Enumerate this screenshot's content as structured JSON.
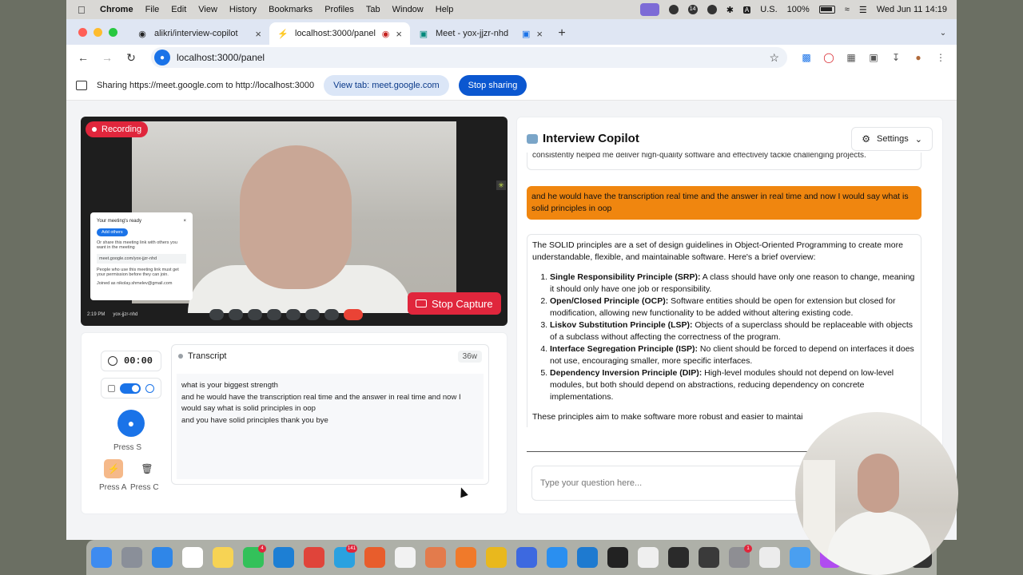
{
  "menubar": {
    "app_name": "Chrome",
    "items": [
      "File",
      "Edit",
      "View",
      "History",
      "Bookmarks",
      "Profiles",
      "Tab",
      "Window",
      "Help"
    ],
    "notification_count": "14",
    "input_source": "U.S.",
    "battery": "100%",
    "datetime": "Wed Jun 11  14:19"
  },
  "tabs": [
    {
      "title": "alikri/interview-copilot",
      "icon": "github-icon",
      "active": false
    },
    {
      "title": "localhost:3000/panel",
      "icon": "bolt-icon",
      "active": true
    },
    {
      "title": "Meet - yox-jjzr-nhd",
      "icon": "meet-icon",
      "active": false
    }
  ],
  "toolbar": {
    "url": "localhost:3000/panel"
  },
  "sharebar": {
    "message": "Sharing https://meet.google.com to http://localhost:3000",
    "view_tab_label": "View tab: meet.google.com",
    "stop_sharing_label": "Stop sharing"
  },
  "video": {
    "recording_label": "Recording",
    "stop_capture_label": "Stop Capture",
    "meet_time": "2:19 PM",
    "meet_code": "yox-jjzr-nhd",
    "meet_card": {
      "title": "Your meeting's ready",
      "add_others": "Add others",
      "share_text": "Or share this meeting link with others you want in the meeting",
      "link": "meet.google.com/yox-jjzr-nhd",
      "note": "People who use this meeting link must get your permission before they can join.",
      "joined_as": "Joined as nikolay.shmelev@gmail.com"
    }
  },
  "controls": {
    "timer": "00:00",
    "press_s": "Press  S",
    "press_a": "Press  A",
    "press_c": "Press  C"
  },
  "transcript": {
    "title": "Transcript",
    "word_count": "36w",
    "lines": [
      "what is your biggest strength",
      "and he would have the transcription real time and the answer in real time and now I would say what is solid principles in oop",
      "and you have solid principles thank you bye"
    ]
  },
  "copilot": {
    "title": "Interview Copilot",
    "settings_label": "Settings",
    "prev_message": "consistently helped me deliver high-quality software and effectively tackle challenging projects.",
    "user_message": "and he would have the transcription real time and the answer in real time and now I would say what is solid principles in oop",
    "ai_intro": "The SOLID principles are a set of design guidelines in Object-Oriented Programming to create more understandable, flexible, and maintainable software. Here's a brief overview:",
    "principles": [
      {
        "term": "Single Responsibility Principle (SRP):",
        "desc": " A class should have only one reason to change, meaning it should only have one job or responsibility."
      },
      {
        "term": "Open/Closed Principle (OCP):",
        "desc": " Software entities should be open for extension but closed for modification, allowing new functionality to be added without altering existing code."
      },
      {
        "term": "Liskov Substitution Principle (LSP):",
        "desc": " Objects of a superclass should be replaceable with objects of a subclass without affecting the correctness of the program."
      },
      {
        "term": "Interface Segregation Principle (ISP):",
        "desc": " No client should be forced to depend on interfaces it does not use, encouraging smaller, more specific interfaces."
      },
      {
        "term": "Dependency Inversion Principle (DIP):",
        "desc": " High-level modules should not depend on low-level modules, but both should depend on abstractions, reducing dependency on concrete implementations."
      }
    ],
    "ai_outro": "These principles aim to make software more robust and easier to maintai",
    "input_placeholder": "Type your question here..."
  },
  "dock": {
    "icons": [
      {
        "name": "finder-icon",
        "color": "#3d8bf0"
      },
      {
        "name": "launchpad-icon",
        "color": "#8a8f99"
      },
      {
        "name": "safari-icon",
        "color": "#2f86e8"
      },
      {
        "name": "calendar-icon",
        "color": "#ffffff"
      },
      {
        "name": "notes-icon",
        "color": "#f7d354"
      },
      {
        "name": "whatsapp-icon",
        "color": "#33c15a",
        "badge": "4"
      },
      {
        "name": "trello-icon",
        "color": "#1d7fd4"
      },
      {
        "name": "todoist-icon",
        "color": "#e0443a"
      },
      {
        "name": "telegram-icon",
        "color": "#2aa1e0",
        "badge": "141"
      },
      {
        "name": "duckduckgo-icon",
        "color": "#e85d2c"
      },
      {
        "name": "chatgpt-icon",
        "color": "#f2f2f2"
      },
      {
        "name": "claude-icon",
        "color": "#e37b4c"
      },
      {
        "name": "firefox-icon",
        "color": "#f07a2a"
      },
      {
        "name": "chrome-icon",
        "color": "#e9b81d"
      },
      {
        "name": "arc-icon",
        "color": "#3d69e0"
      },
      {
        "name": "appstore-icon",
        "color": "#2a8ff0"
      },
      {
        "name": "vscode-icon",
        "color": "#1e7ad0"
      },
      {
        "name": "intellij-icon",
        "color": "#222222"
      },
      {
        "name": "vim-icon",
        "color": "#efefef"
      },
      {
        "name": "terminal-icon",
        "color": "#2a2a2a"
      },
      {
        "name": "editor-icon",
        "color": "#3a3a3a"
      },
      {
        "name": "settings-icon",
        "color": "#8e8e93",
        "badge": "1"
      },
      {
        "name": "calculator-icon",
        "color": "#ececec"
      },
      {
        "name": "mail-icon",
        "color": "#4a9ff0"
      },
      {
        "name": "figma-icon",
        "color": "#b04cf0"
      },
      {
        "name": "pineapple-icon",
        "color": "#f0c040"
      },
      {
        "name": "capcut-icon",
        "color": "#ffffff"
      },
      {
        "name": "app-icon",
        "color": "#333333"
      }
    ]
  },
  "colors": {
    "recording_red": "#e0263c",
    "user_bubble": "#f0860f",
    "accent_blue": "#1a73e8"
  }
}
